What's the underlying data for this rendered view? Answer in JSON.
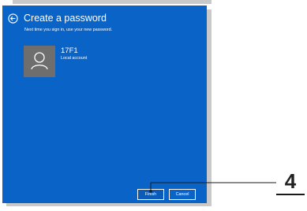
{
  "dialog": {
    "title": "Create a password",
    "subtitle": "Next time you sign in, use your new password.",
    "back_icon": "back-arrow-icon",
    "background_color": "#0a64c8"
  },
  "account": {
    "name": "17F1",
    "type": "Local account",
    "avatar_icon": "user-icon"
  },
  "buttons": {
    "finish_label": "Finish",
    "cancel_label": "Cancel"
  },
  "callout": {
    "step_number": "4"
  }
}
